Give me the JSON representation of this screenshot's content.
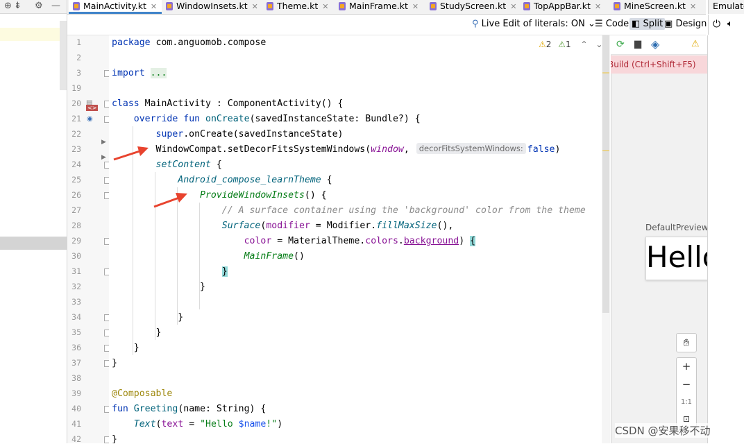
{
  "left_panel": {
    "toolbar_icons": [
      "globe-icon",
      "collapse-icon",
      "gear-icon",
      "minimize-icon"
    ]
  },
  "tabs": [
    {
      "label": "MainActivity.kt",
      "active": true
    },
    {
      "label": "WindowInsets.kt",
      "active": false
    },
    {
      "label": "Theme.kt",
      "active": false
    },
    {
      "label": "MainFrame.kt",
      "active": false
    },
    {
      "label": "StudyScreen.kt",
      "active": false
    },
    {
      "label": "TopAppBar.kt",
      "active": false
    },
    {
      "label": "MineScreen.kt",
      "active": false
    }
  ],
  "emulator_tab": "Emulator",
  "toolbar": {
    "live_edit": "Live Edit of literals: ON",
    "code": "Code",
    "split": "Split",
    "design": "Design"
  },
  "inspections": {
    "warnings": "2",
    "weak_warnings": "1"
  },
  "line_numbers": [
    "1",
    "2",
    "3",
    "19",
    "20",
    "21",
    "22",
    "23",
    "24",
    "25",
    "26",
    "27",
    "28",
    "29",
    "30",
    "31",
    "32",
    "33",
    "34",
    "35",
    "36",
    "37",
    "38",
    "39",
    "40",
    "41",
    "42"
  ],
  "code": {
    "package_kw": "package",
    "package_name": " com.anguomob.compose",
    "import_kw": "import",
    "import_dots": "...",
    "class_kw": "class",
    "class_decl": " MainActivity : ComponentActivity() {",
    "override_kw": "override",
    "fun_kw": "fun",
    "oncreate_fn": "onCreate",
    "oncreate_params": "(savedInstanceState: Bundle?) {",
    "super_kw": "super",
    "super_call": ".onCreate(savedInstanceState)",
    "window_compat": "WindowCompat.setDecorFitsSystemWindows(",
    "window_arg": "window",
    "comma": ",",
    "param_hint": "decorFitsSystemWindows:",
    "false_kw": "false",
    "close_paren": ")",
    "set_content": "setContent",
    "open_brace": " {",
    "theme_call": "Android_compose_learnTheme",
    "provide_insets": "ProvideWindowInsets",
    "provide_suffix": "() {",
    "comment": "// A surface container using the 'background' color from the theme",
    "surface": "Surface",
    "modifier_param": "modifier",
    "equals": " = ",
    "modifier_obj": "Modifier.",
    "fill_max": "fillMaxSize",
    "paren_comma": "(),",
    "color_param": "color",
    "material_theme": "MaterialTheme.",
    "colors_prop": "colors",
    "dot": ".",
    "background_prop": "background",
    "brace_open": "{",
    "main_frame": "MainFrame",
    "parens": "()",
    "brace_close": "}",
    "composable_ann": "@Composable",
    "greeting_fn": "Greeting",
    "greeting_params": "(name: String) {",
    "text_fn": "Text",
    "text_param": "text",
    "string_literal": "\"Hello $name!\")",
    "str_start": "\"Hello ",
    "str_var": "$name",
    "str_end": "!\"",
    "last_paren": ")"
  },
  "preview": {
    "build_banner": "Build (Ctrl+Shift+F5)",
    "title": "DefaultPreview",
    "content_text": "Hello",
    "zoom_in": "+",
    "zoom_out": "−",
    "zoom_reset": "1:1"
  },
  "watermark": "CSDN @安果移不动",
  "colors": {
    "keyword": "#0033b3",
    "function": "#00627a",
    "composable": "#067d17",
    "param": "#871094",
    "comment": "#8c8c8c",
    "annotation": "#9e880d",
    "arrow": "#e8432e",
    "error_banner": "#f8d7da"
  }
}
